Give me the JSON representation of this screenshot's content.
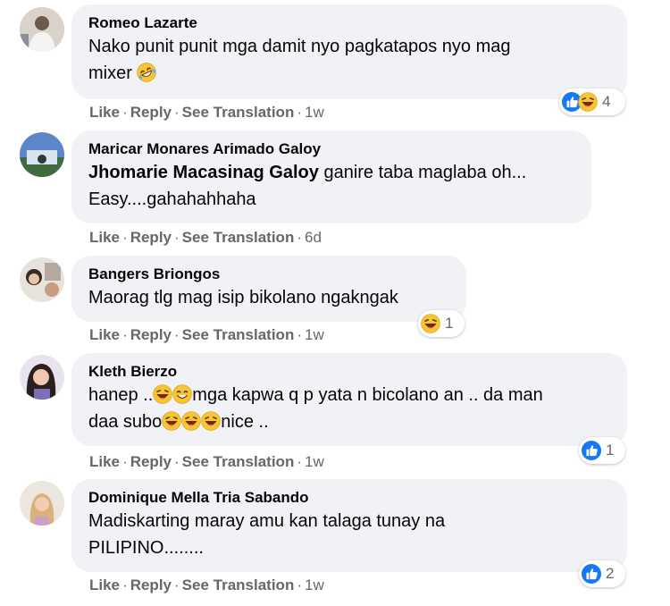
{
  "comments": [
    {
      "author": "Romeo Lazarte",
      "line1": "Nako punit punit mga damit nyo pagkatapos nyo mag",
      "line2": "mixer",
      "actions": {
        "like": "Like",
        "reply": "Reply",
        "translate": "See Translation",
        "time": "1w"
      },
      "reaction_count": "4"
    },
    {
      "author": "Maricar Monares Arimado Galoy",
      "mention": "Jhomarie Macasinag Galoy",
      "line1": " ganire taba maglaba oh...",
      "line2": "Easy....gahahahhaha",
      "actions": {
        "like": "Like",
        "reply": "Reply",
        "translate": "See Translation",
        "time": "6d"
      }
    },
    {
      "author": "Bangers Briongos",
      "line1": "Maorag tlg mag isip bikolano ngakngak",
      "actions": {
        "like": "Like",
        "reply": "Reply",
        "translate": "See Translation",
        "time": "1w"
      },
      "reaction_count": "1"
    },
    {
      "author": "Kleth Bierzo",
      "line1a": "hanep ..",
      "line1b": "mga kapwa q p yata n bicolano an .. da man",
      "line2a": "daa subo",
      "line2b": "nice ..",
      "actions": {
        "like": "Like",
        "reply": "Reply",
        "translate": "See Translation",
        "time": "1w"
      },
      "reaction_count": "1"
    },
    {
      "author": "Dominique Mella Tria Sabando",
      "line1": "Madiskarting maray amu kan talaga tunay na",
      "line2": "PILIPINO........",
      "actions": {
        "like": "Like",
        "reply": "Reply",
        "translate": "See Translation",
        "time": "1w"
      },
      "reaction_count": "2"
    }
  ],
  "colors": {
    "bubble": "#f0f2f5",
    "like_blue": "#1877f2",
    "emoji_yellow": "#f7b928",
    "meta_gray": "#65676b"
  }
}
